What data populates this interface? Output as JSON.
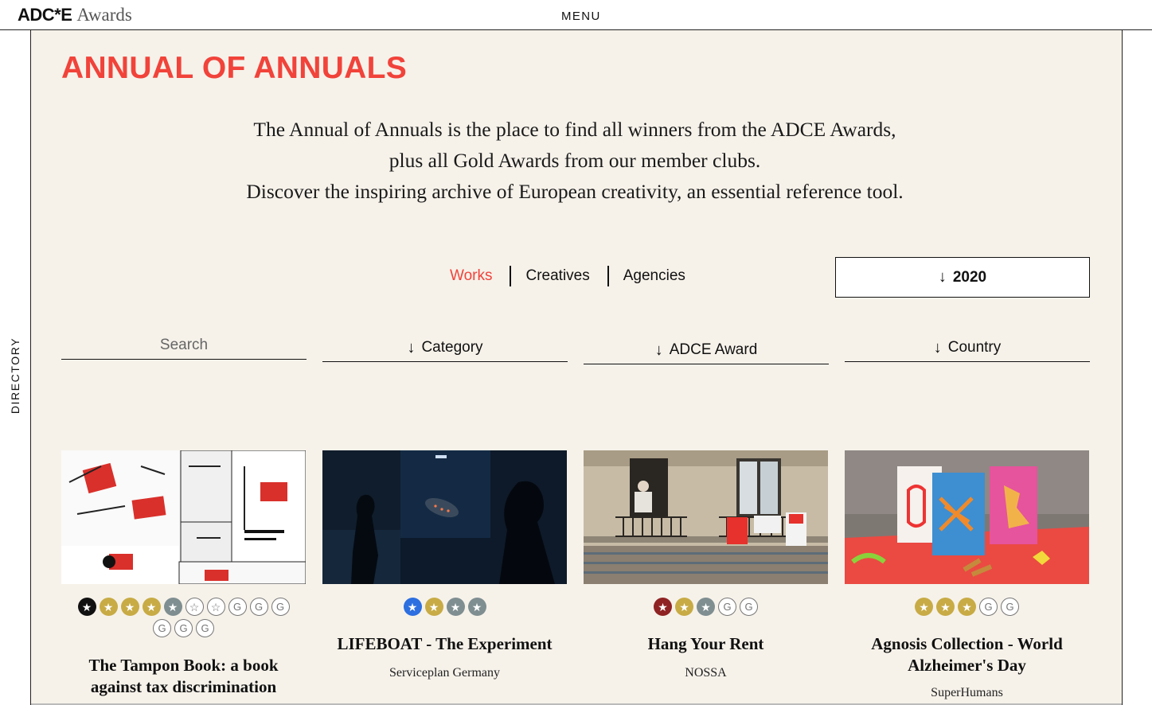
{
  "header": {
    "logo_mark": "ADC*E",
    "logo_word": "Awards",
    "menu_label": "MENU"
  },
  "sidebar": {
    "directory_label": "DIRECTORY"
  },
  "main": {
    "title": "ANNUAL OF ANNUALS",
    "intro_lines": [
      "The Annual of Annuals is the place to find all winners from the ADCE Awards,",
      "plus all Gold Awards from our member clubs.",
      "Discover the inspiring archive of European creativity, an essential reference tool."
    ],
    "tabs": [
      {
        "label": "Works",
        "active": true
      },
      {
        "label": "Creatives",
        "active": false
      },
      {
        "label": "Agencies",
        "active": false
      }
    ],
    "year_selector": {
      "arrow": "↓",
      "value": "2020"
    },
    "filters": {
      "search_placeholder": "Search",
      "arrow": "↓",
      "category_label": "Category",
      "award_label": "ADCE Award",
      "country_label": "Country"
    }
  },
  "icons": {
    "star_filled": "★",
    "star_outline": "☆",
    "gold_club_letter": "G",
    "down_arrow": "↓"
  },
  "colors": {
    "accent": "#f1433a",
    "background": "#f6f2ea",
    "grand_prix": "#111111",
    "gold": "#c8ab45",
    "silver": "#7f8e91",
    "blue": "#2d6fe0",
    "red": "#8f2323"
  },
  "cards": [
    {
      "title": "The Tampon Book: a book against tax discrimination",
      "agency": "",
      "badges": [
        "black",
        "gold",
        "gold",
        "gold",
        "silver",
        "outline",
        "outline",
        "g",
        "g",
        "g",
        "g",
        "g",
        "g"
      ]
    },
    {
      "title": "LIFEBOAT - The Experiment",
      "agency": "Serviceplan Germany",
      "badges": [
        "blue",
        "gold",
        "silver",
        "silver"
      ]
    },
    {
      "title": "Hang Your Rent",
      "agency": "NOSSA",
      "badges": [
        "red",
        "gold",
        "silver",
        "g",
        "g"
      ]
    },
    {
      "title": "Agnosis Collection - World Alzheimer's Day",
      "agency": "SuperHumans",
      "badges": [
        "gold",
        "gold",
        "gold",
        "g",
        "g"
      ]
    }
  ]
}
